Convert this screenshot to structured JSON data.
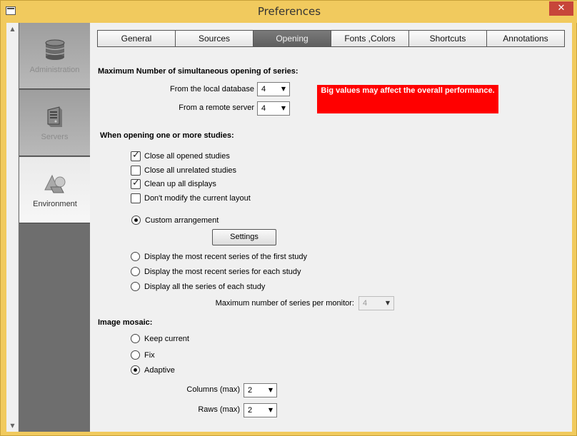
{
  "window": {
    "title": "Preferences",
    "close_glyph": "✕"
  },
  "scrollbar": {
    "up_glyph": "▲",
    "down_glyph": "▼"
  },
  "sidenav": {
    "items": [
      {
        "label": "Administration",
        "icon": "database-icon",
        "active": false
      },
      {
        "label": "Servers",
        "icon": "server-icon",
        "active": false
      },
      {
        "label": "Environment",
        "icon": "shapes-icon",
        "active": true
      }
    ]
  },
  "tabs": [
    {
      "label": "General",
      "active": false
    },
    {
      "label": "Sources",
      "active": false
    },
    {
      "label": "Opening",
      "active": true
    },
    {
      "label": "Fonts ,Colors",
      "active": false
    },
    {
      "label": "Shortcuts",
      "active": false
    },
    {
      "label": "Annotations",
      "active": false
    }
  ],
  "max_open": {
    "heading": "Maximum Number of simultaneous opening of series:",
    "local_label": "From the local database",
    "local_value": "4",
    "remote_label": "From a remote server",
    "remote_value": "4",
    "warning": "Big values may affect the overall performance."
  },
  "studies": {
    "heading": "When opening one or more studies:",
    "checks": [
      {
        "label": "Close all opened studies",
        "checked": true
      },
      {
        "label": "Close all unrelated studies",
        "checked": false
      },
      {
        "label": "Clean up all displays",
        "checked": true
      },
      {
        "label": "Don't modify the current layout",
        "checked": false
      }
    ],
    "custom_arrangement": "Custom arrangement",
    "settings_button": "Settings",
    "options": [
      "Display the most recent series of the first study",
      "Display the most recent series for each study",
      "Display all the series of each study"
    ],
    "max_per_monitor_label": "Maximum number of series per monitor:",
    "max_per_monitor_value": "4"
  },
  "mosaic": {
    "heading": "Image mosaic:",
    "options": [
      "Keep current",
      "Fix",
      "Adaptive"
    ],
    "selected": "Adaptive",
    "columns_label": "Columns (max)",
    "columns_value": "2",
    "rows_label": "Raws (max)",
    "rows_value": "2"
  },
  "colors": {
    "warning_bg": "#ff0000",
    "close_button": "#c7463a",
    "title_bar": "#f1ca5e"
  }
}
